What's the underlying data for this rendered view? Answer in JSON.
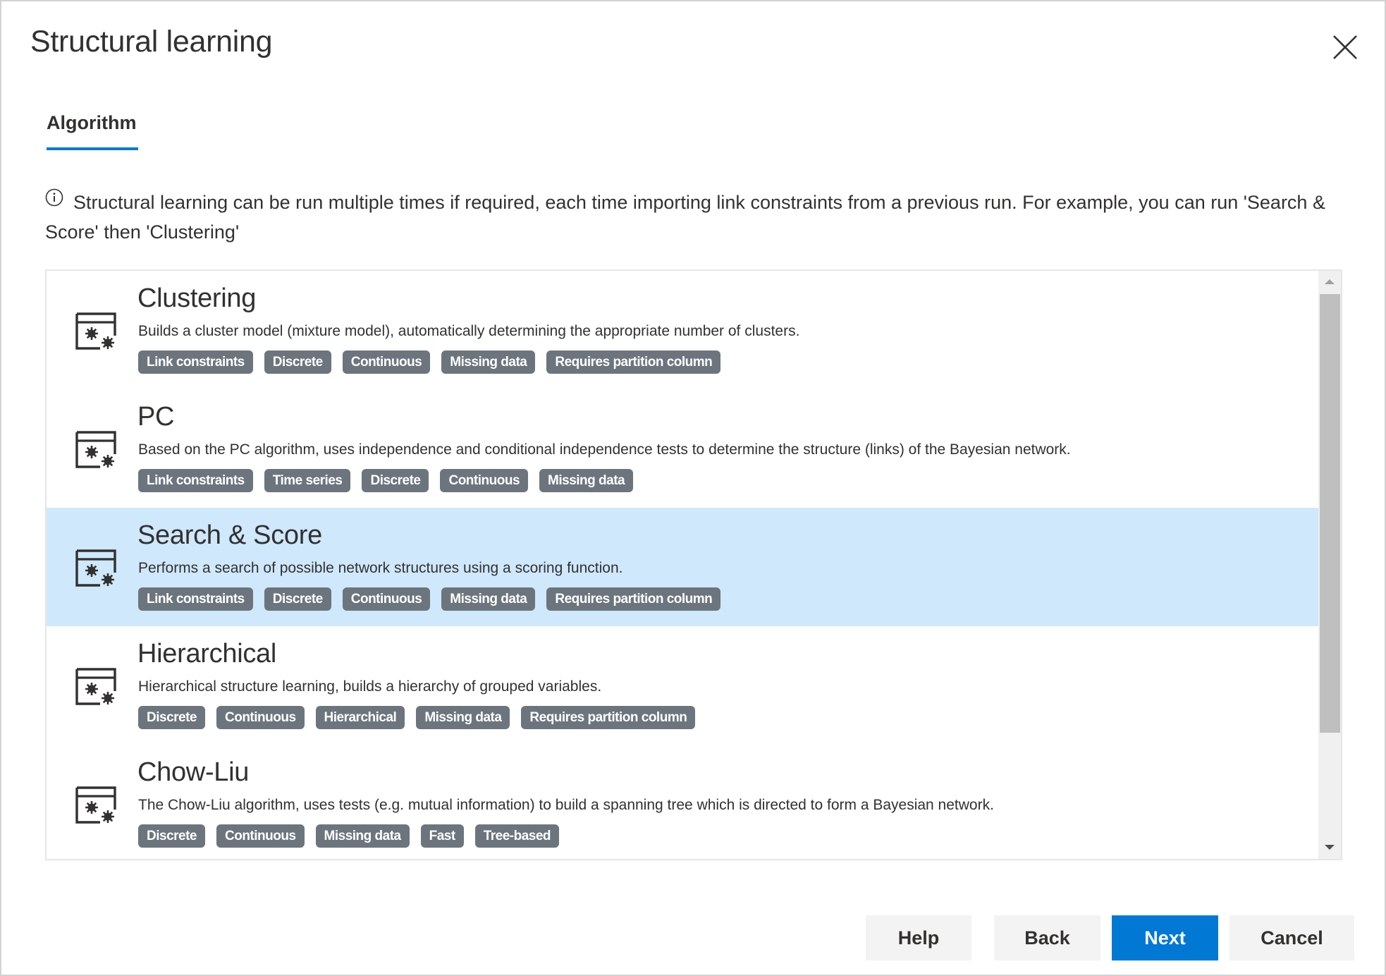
{
  "dialog": {
    "title": "Structural learning",
    "close_icon": "close-icon"
  },
  "tabs": [
    {
      "label": "Algorithm",
      "active": true
    }
  ],
  "info": {
    "icon": "info-icon",
    "text": "Structural learning can be run multiple times if required, each time importing link constraints from a previous run. For example, you can run 'Search & Score' then 'Clustering'"
  },
  "algorithms": [
    {
      "name": "Clustering",
      "icon": "window-gears-icon",
      "description": "Builds a cluster model (mixture model), automatically determining the appropriate number of clusters.",
      "tags": [
        "Link constraints",
        "Discrete",
        "Continuous",
        "Missing data",
        "Requires partition column"
      ],
      "selected": false
    },
    {
      "name": "PC",
      "icon": "window-gears-icon",
      "description": "Based on the PC algorithm, uses independence and conditional independence tests to determine the structure (links) of the Bayesian network.",
      "tags": [
        "Link constraints",
        "Time series",
        "Discrete",
        "Continuous",
        "Missing data"
      ],
      "selected": false
    },
    {
      "name": "Search & Score",
      "icon": "window-gears-icon",
      "description": "Performs a search of possible network structures using a scoring function.",
      "tags": [
        "Link constraints",
        "Discrete",
        "Continuous",
        "Missing data",
        "Requires partition column"
      ],
      "selected": true
    },
    {
      "name": "Hierarchical",
      "icon": "window-gears-icon",
      "description": "Hierarchical structure learning, builds a hierarchy of grouped variables.",
      "tags": [
        "Discrete",
        "Continuous",
        "Hierarchical",
        "Missing data",
        "Requires partition column"
      ],
      "selected": false
    },
    {
      "name": "Chow-Liu",
      "icon": "window-gears-icon",
      "description": "The Chow-Liu algorithm, uses tests (e.g. mutual information) to build a spanning tree which is directed to form a Bayesian network.",
      "tags": [
        "Discrete",
        "Continuous",
        "Missing data",
        "Fast",
        "Tree-based"
      ],
      "selected": false
    }
  ],
  "buttons": {
    "help": "Help",
    "back": "Back",
    "next": "Next",
    "cancel": "Cancel"
  },
  "colors": {
    "accent": "#0078d4",
    "selected_row": "#cfe8fc",
    "tag_bg": "#6c757d",
    "button_bg": "#f3f3f3"
  }
}
